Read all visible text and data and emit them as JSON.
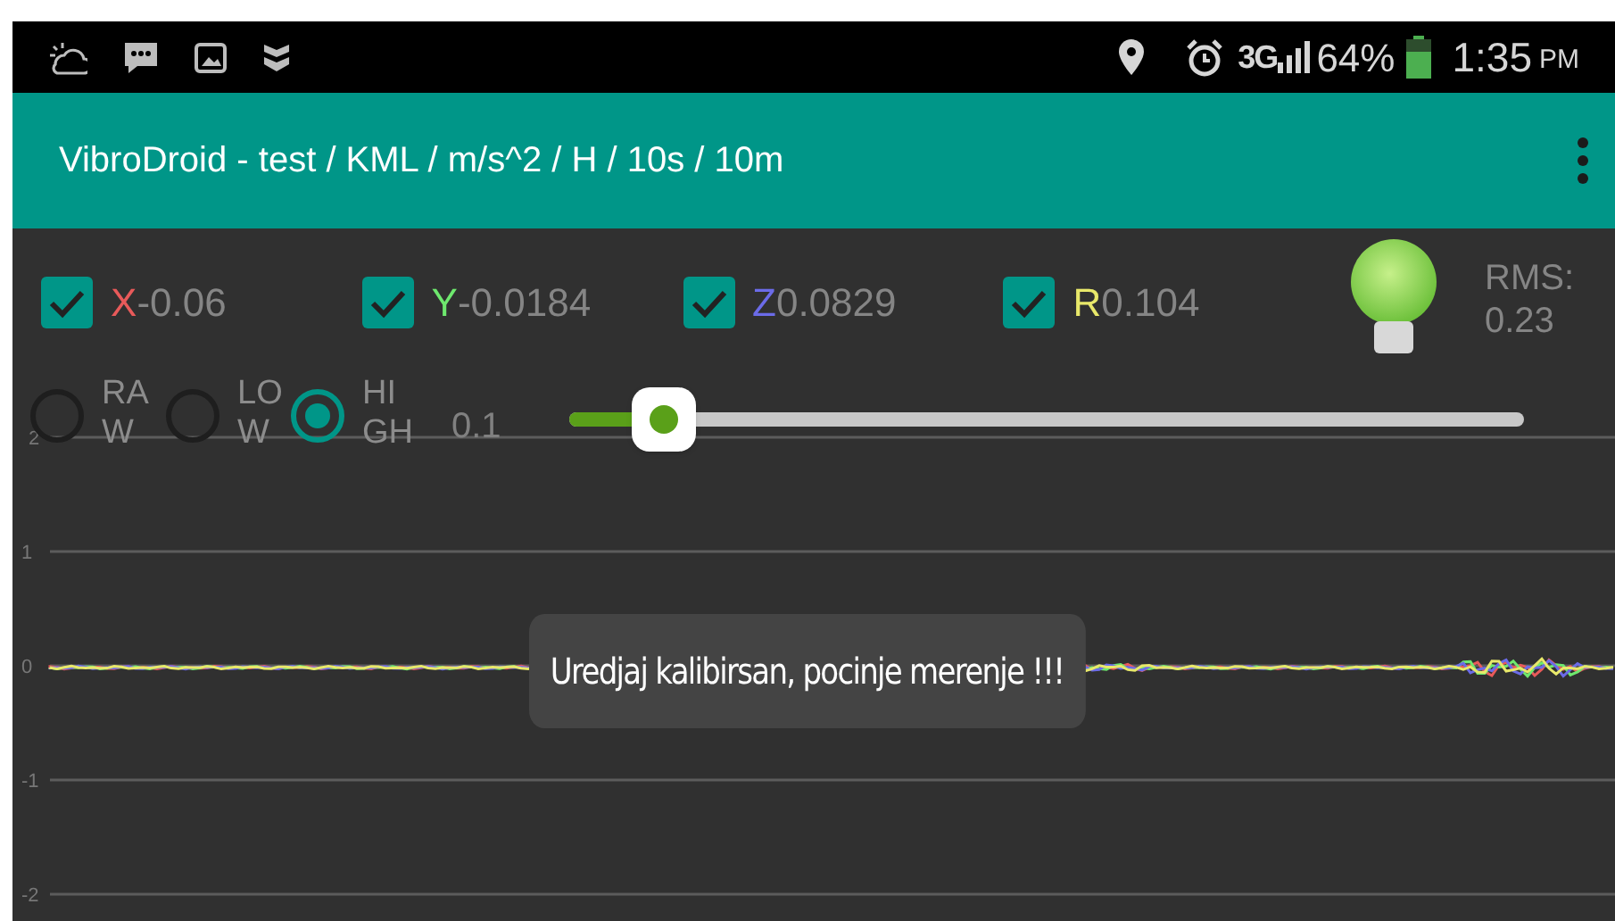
{
  "status_bar": {
    "network": "3G",
    "battery": "64%",
    "time": "1:35",
    "ampm": "PM"
  },
  "app_bar": {
    "title": "VibroDroid - test / KML / m/s^2 / H / 10s / 10m"
  },
  "channels": [
    {
      "letter": "X",
      "value": "-0.06",
      "checked": true,
      "color": "#e85a5a"
    },
    {
      "letter": "Y",
      "value": "-0.0184",
      "checked": true,
      "color": "#6ee86e"
    },
    {
      "letter": "Z",
      "value": "0.0829",
      "checked": true,
      "color": "#6b6be8"
    },
    {
      "letter": "R",
      "value": "0.104",
      "checked": true,
      "color": "#e8e86a"
    }
  ],
  "indicator": {
    "on": true,
    "rms_label": "RMS:",
    "rms_value": "0.23"
  },
  "filters": [
    {
      "label": "RAW",
      "selected": false
    },
    {
      "label": "LOW",
      "selected": false
    },
    {
      "label": "HIGH",
      "selected": true
    }
  ],
  "cutoff": {
    "reading": "0.1",
    "level": 0.1
  },
  "chart": {
    "y_ticks": [
      "2",
      "1",
      "0",
      "-1",
      "-2"
    ]
  },
  "toast": {
    "text": "Uredjaj kalibirsan, pocinje merenje !!!"
  }
}
